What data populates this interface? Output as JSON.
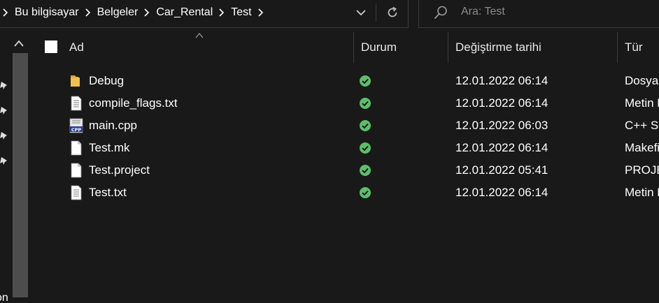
{
  "address": {
    "crumbs": [
      "Bu bilgisayar",
      "Belgeler",
      "Car_Rental",
      "Test"
    ]
  },
  "search": {
    "placeholder": "Ara: Test"
  },
  "nav": {
    "cut_text": "on"
  },
  "columns": {
    "name": "Ad",
    "status": "Durum",
    "modified": "Değiştirme tarihi",
    "type": "Tür"
  },
  "files": [
    {
      "name": "Debug",
      "icon": "folder-icon",
      "status": "synced-check-icon",
      "modified": "12.01.2022 06:14",
      "type": "Dosya klasörü"
    },
    {
      "name": "compile_flags.txt",
      "icon": "text-file-icon",
      "status": "synced-check-icon",
      "modified": "12.01.2022 06:14",
      "type": "Metin Belgesi"
    },
    {
      "name": "main.cpp",
      "icon": "cpp-file-icon",
      "status": "synced-check-icon",
      "modified": "12.01.2022 06:03",
      "type": "C++ Source"
    },
    {
      "name": "Test.mk",
      "icon": "blank-file-icon",
      "status": "synced-check-icon",
      "modified": "12.01.2022 06:14",
      "type": "Makefile"
    },
    {
      "name": "Test.project",
      "icon": "blank-file-icon",
      "status": "synced-check-icon",
      "modified": "12.01.2022 05:41",
      "type": "PROJECT Dosyası"
    },
    {
      "name": "Test.txt",
      "icon": "text-file-icon",
      "status": "synced-check-icon",
      "modified": "12.01.2022 06:14",
      "type": "Metin Belgesi"
    }
  ],
  "colors": {
    "background": "#191919",
    "border": "#3a3a3a",
    "folder": "#f0c14b",
    "sync_ok": "#5bbf6a",
    "scrollbar": "#4d4d4d"
  }
}
